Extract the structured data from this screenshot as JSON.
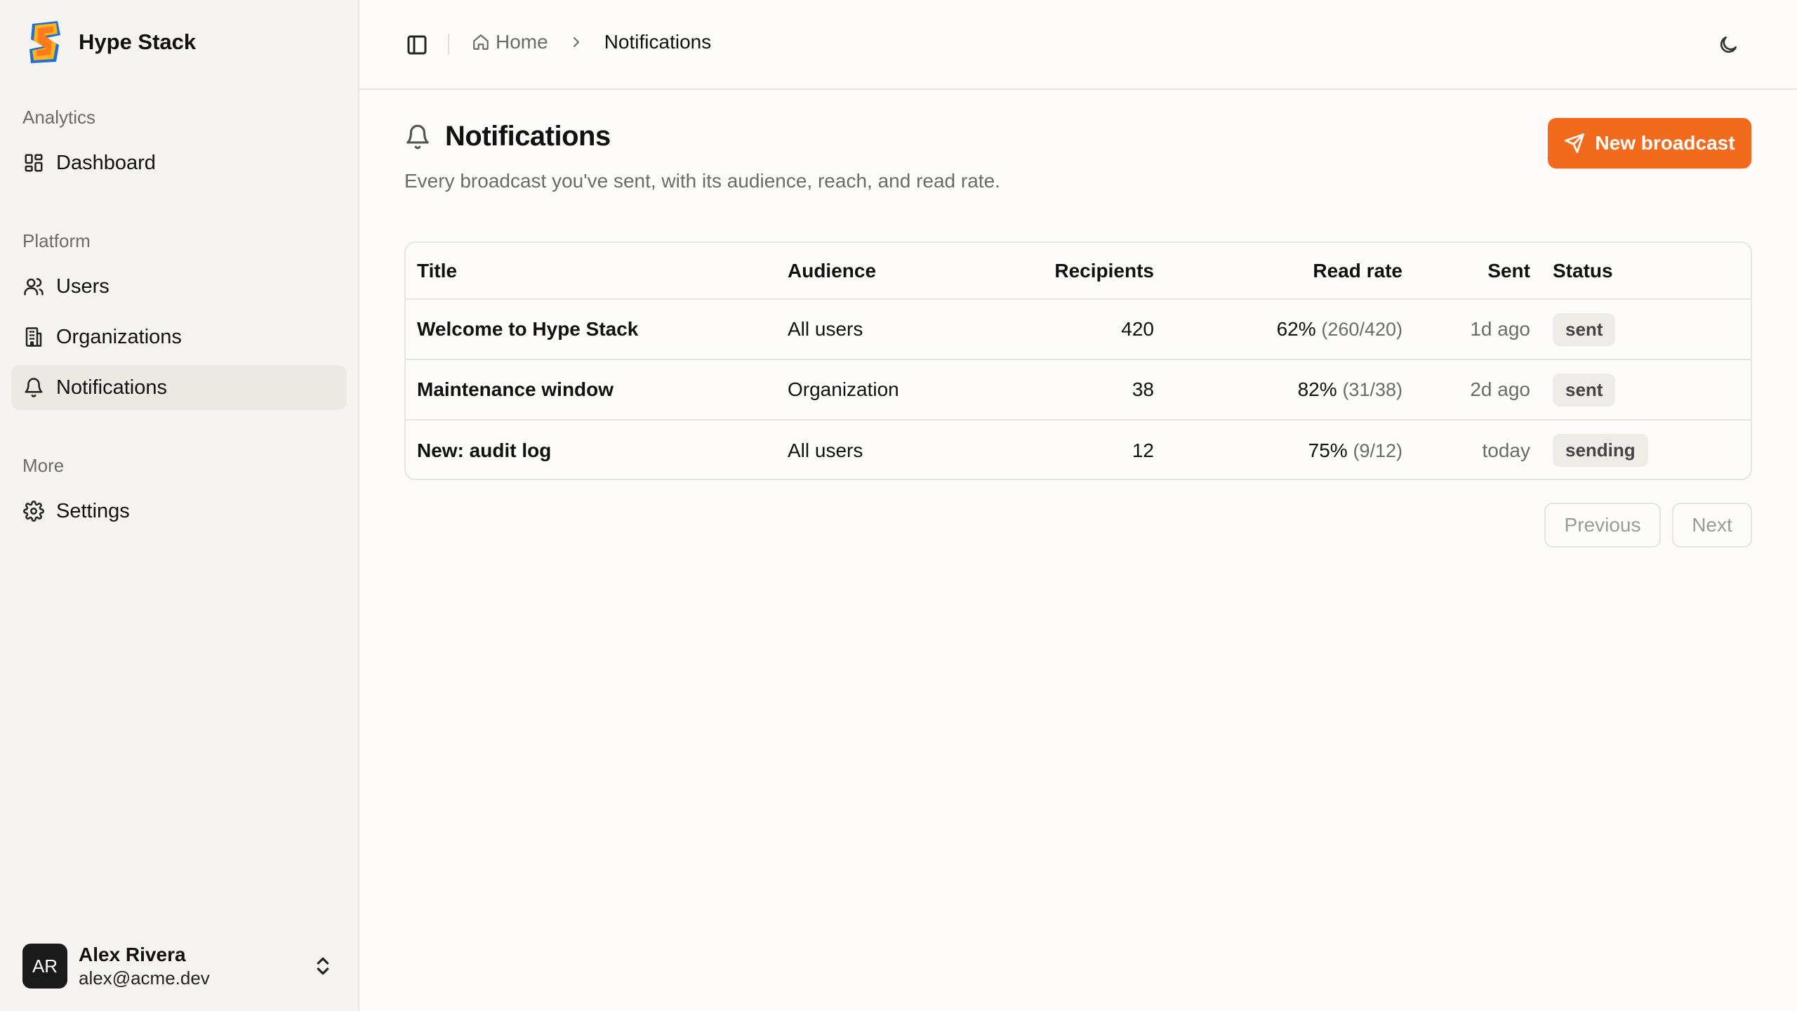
{
  "brand": {
    "name": "Hype Stack"
  },
  "sidebar": {
    "groups": [
      {
        "label": "Analytics",
        "items": [
          {
            "label": "Dashboard",
            "icon": "dashboard-icon"
          }
        ]
      },
      {
        "label": "Platform",
        "items": [
          {
            "label": "Users",
            "icon": "users-icon"
          },
          {
            "label": "Organizations",
            "icon": "building-icon"
          },
          {
            "label": "Notifications",
            "icon": "bell-icon",
            "active": true
          }
        ]
      },
      {
        "label": "More",
        "items": [
          {
            "label": "Settings",
            "icon": "gear-icon"
          }
        ]
      }
    ],
    "user": {
      "initials": "AR",
      "name": "Alex Rivera",
      "email": "alex@acme.dev"
    }
  },
  "header": {
    "breadcrumb": {
      "home": "Home",
      "current": "Notifications"
    }
  },
  "main": {
    "title": "Notifications",
    "subtitle": "Every broadcast you've sent, with its audience, reach, and read rate.",
    "primary_action": "New broadcast",
    "table": {
      "columns": [
        "Title",
        "Audience",
        "Recipients",
        "Read rate",
        "Sent",
        "Status"
      ],
      "rows": [
        {
          "title": "Welcome to Hype Stack",
          "audience": "All users",
          "recipients": "420",
          "read_rate": "62%",
          "read_fraction": "(260/420)",
          "sent": "1d ago",
          "status": "sent"
        },
        {
          "title": "Maintenance window",
          "audience": "Organization",
          "recipients": "38",
          "read_rate": "82%",
          "read_fraction": "(31/38)",
          "sent": "2d ago",
          "status": "sent"
        },
        {
          "title": "New: audit log",
          "audience": "All users",
          "recipients": "12",
          "read_rate": "75%",
          "read_fraction": "(9/12)",
          "sent": "today",
          "status": "sending"
        }
      ]
    },
    "pagination": {
      "previous": "Previous",
      "next": "Next"
    }
  },
  "colors": {
    "accent": "#f26b1d",
    "sidebar_bg": "#f6f4f1",
    "page_bg": "#fcfbf9"
  }
}
